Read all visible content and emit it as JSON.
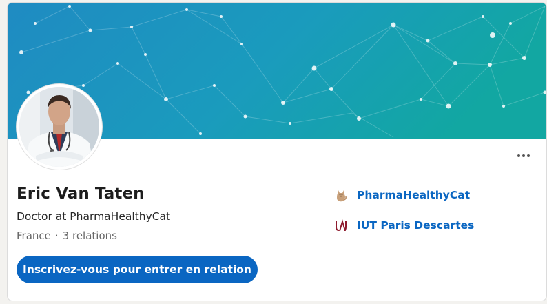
{
  "profile": {
    "name": "Eric Van Taten",
    "headline": "Doctor at PharmaHealthyCat",
    "location": "France",
    "separator": "·",
    "relations": "3 relations",
    "cta_label": "Inscrivez-vous pour entrer en relation"
  },
  "affiliations": [
    {
      "label": "PharmaHealthyCat",
      "icon": "cat-logo-icon"
    },
    {
      "label": "IUT Paris Descartes",
      "icon": "university-logo-icon"
    }
  ],
  "colors": {
    "accent": "#0a66c2",
    "banner_start": "#1f8bc2",
    "banner_end": "#12a7a2",
    "university_red": "#8e1b2e"
  }
}
